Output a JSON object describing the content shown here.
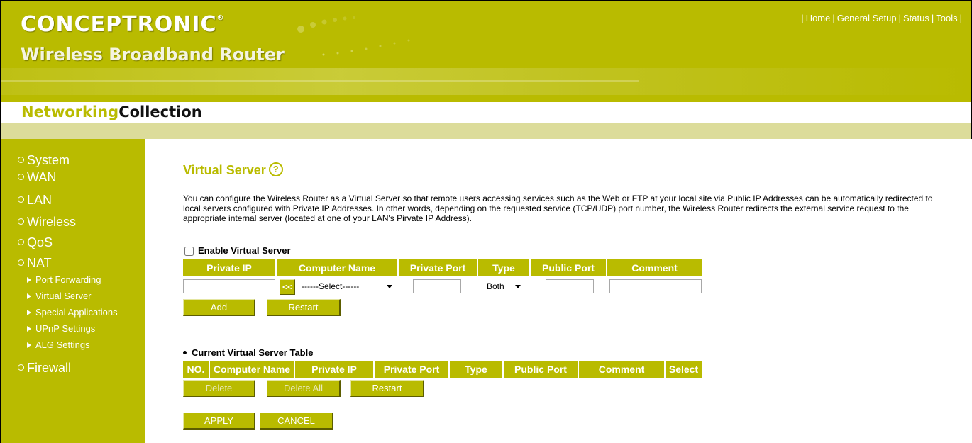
{
  "header": {
    "logo": "CONCEPTRONIC",
    "logo_reg": "®",
    "subtitle": "Wireless Broadband Router",
    "nav": [
      "Home",
      "General Setup",
      "Status",
      "Tools"
    ]
  },
  "collection": {
    "part1": "Networking",
    "part2": "Collection"
  },
  "sidebar": {
    "items": [
      "System",
      "WAN",
      "LAN",
      "Wireless",
      "QoS",
      "NAT",
      "Firewall"
    ],
    "nat_sub": [
      "Port Forwarding",
      "Virtual Server",
      "Special Applications",
      "UPnP Settings",
      "ALG Settings"
    ]
  },
  "page": {
    "title": "Virtual Server",
    "help_glyph": "?",
    "description": "You can configure the Wireless Router as a Virtual Server so that remote users accessing services such as the Web or FTP at your local site via Public IP Addresses can be automatically redirected to local servers configured with Private IP Addresses. In other words, depending on the requested service (TCP/UDP) port number, the Wireless Router redirects the external service request to the appropriate internal server (located at one of your LAN's Pirvate IP Address).",
    "enable_label": "Enable Virtual Server"
  },
  "form": {
    "headers": [
      "Private IP",
      "Computer Name",
      "Private Port",
      "Type",
      "Public Port",
      "Comment"
    ],
    "copy_button": "<<",
    "computer_select": "------Select------",
    "type_select": "Both",
    "add_button": "Add",
    "restart_button": "Restart"
  },
  "table": {
    "title": "Current Virtual Server Table",
    "headers": [
      "NO.",
      "Computer Name",
      "Private IP",
      "Private Port",
      "Type",
      "Public Port",
      "Comment",
      "Select"
    ],
    "delete_button": "Delete",
    "delete_all_button": "Delete All",
    "restart_button": "Restart"
  },
  "footer": {
    "apply": "APPLY",
    "cancel": "CANCEL"
  },
  "colors": {
    "accent": "#b9bb00",
    "strip": "#dcdc9a"
  }
}
